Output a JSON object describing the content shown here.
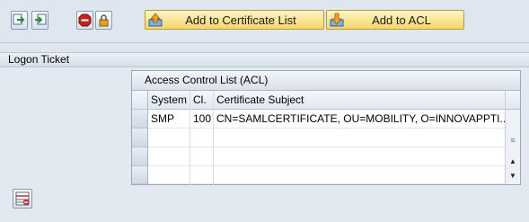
{
  "toolbar": {
    "icons": [
      {
        "name": "copy-to-icon"
      },
      {
        "name": "copy-from-icon"
      },
      {
        "name": "stop-icon"
      },
      {
        "name": "lock-icon"
      }
    ],
    "add_cert_label": "Add to Certificate List",
    "add_acl_label": "Add to ACL"
  },
  "section": {
    "title": "Logon Ticket"
  },
  "acl": {
    "title": "Access Control List (ACL)",
    "columns": [
      "System",
      "Cl.",
      "Certificate Subject"
    ],
    "rows": [
      {
        "system": "SMP",
        "client": "100",
        "subject": "CN=SAMLCERTIFICATE, OU=MOBILITY, O=INNOVAPPTI..."
      }
    ],
    "empty_rows": 3
  },
  "bottom": {
    "icon": "delete-row-icon"
  },
  "colors": {
    "background": "#dfe6ef",
    "button_gold": "#f6d66b",
    "panel_border": "#9aa8ba"
  }
}
